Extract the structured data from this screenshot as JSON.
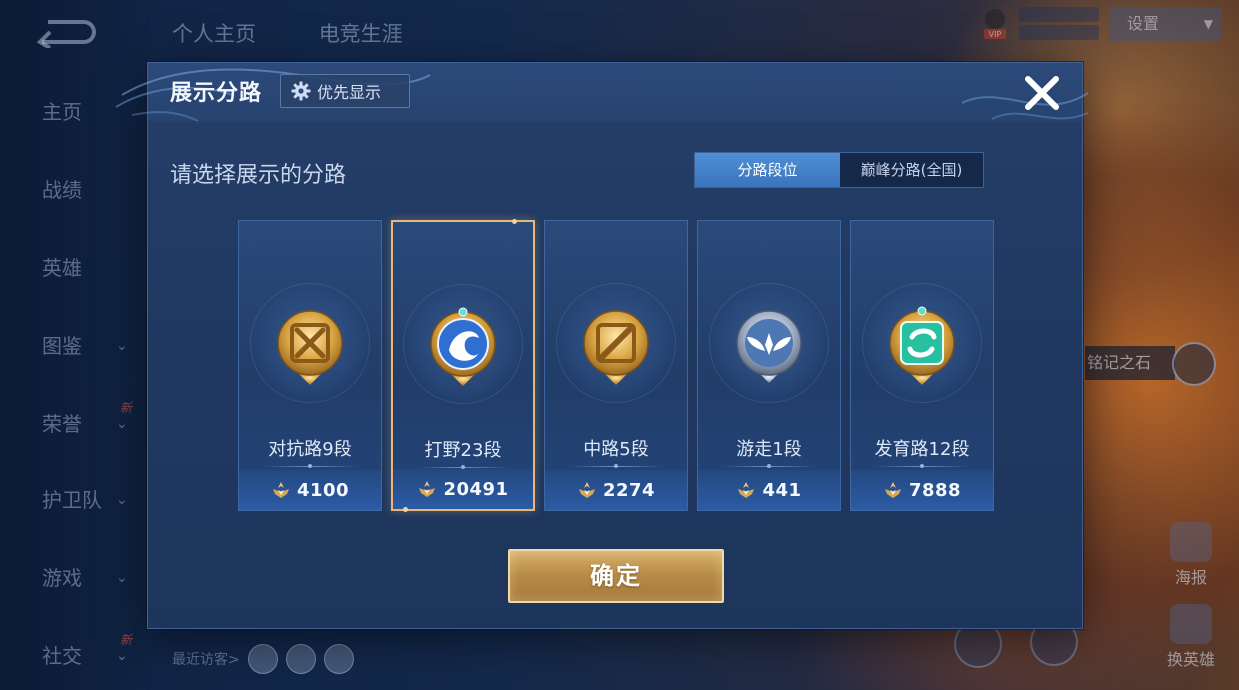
{
  "background": {
    "top_tabs": [
      "个人主页",
      "电竞生涯"
    ],
    "nav_items": [
      {
        "label": "主页",
        "chevron": false,
        "new": false
      },
      {
        "label": "战绩",
        "chevron": false,
        "new": false
      },
      {
        "label": "英雄",
        "chevron": false,
        "new": false
      },
      {
        "label": "图鉴",
        "chevron": true,
        "new": false
      },
      {
        "label": "荣誉",
        "chevron": true,
        "new": true
      },
      {
        "label": "护卫队",
        "chevron": true,
        "new": false
      },
      {
        "label": "游戏",
        "chevron": true,
        "new": false
      },
      {
        "label": "社交",
        "chevron": true,
        "new": true
      }
    ],
    "new_badge": "新",
    "settings_label": "设置",
    "vip_label": "VIP",
    "right_label": "铭记之石",
    "poster_label": "海报",
    "swap_hero_label": "换英雄",
    "recent_visitors_label": "最近访客>"
  },
  "modal": {
    "title": "展示分路",
    "priority_button": "优先显示",
    "subtitle": "请选择展示的分路",
    "toggle": {
      "active": "分路段位",
      "inactive": "巅峰分路(全国)"
    },
    "cards": [
      {
        "label": "对抗路9段",
        "score": "4100",
        "selected": false,
        "emblem": "clash-lane-emblem-icon"
      },
      {
        "label": "打野23段",
        "score": "20491",
        "selected": true,
        "emblem": "jungle-emblem-icon"
      },
      {
        "label": "中路5段",
        "score": "2274",
        "selected": false,
        "emblem": "mid-lane-emblem-icon"
      },
      {
        "label": "游走1段",
        "score": "441",
        "selected": false,
        "emblem": "roam-emblem-icon"
      },
      {
        "label": "发育路12段",
        "score": "7888",
        "selected": false,
        "emblem": "farm-lane-emblem-icon"
      }
    ],
    "confirm_label": "确定"
  },
  "colors": {
    "modal_bg": "#213a63",
    "accent_blue": "#4f8fd6",
    "gold": "#e5b779",
    "confirm_gold": "#c49a55"
  }
}
